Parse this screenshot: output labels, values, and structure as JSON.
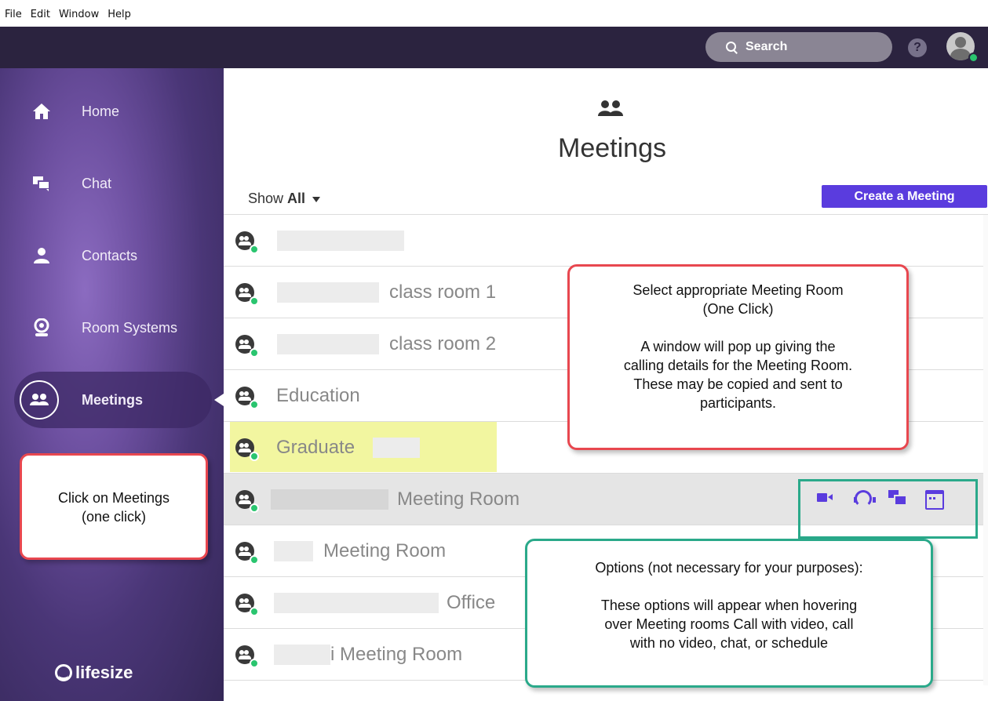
{
  "menu": [
    "File",
    "Edit",
    "Window",
    "Help"
  ],
  "header": {
    "search_label": "Search",
    "help_label": "?"
  },
  "sidebar": {
    "items": [
      {
        "label": "Home"
      },
      {
        "label": "Chat"
      },
      {
        "label": "Contacts"
      },
      {
        "label": "Room Systems"
      },
      {
        "label": "Meetings"
      }
    ],
    "active": "Meetings",
    "logo": "lifesize"
  },
  "main": {
    "title": "Meetings",
    "show_prefix": "Show",
    "show_value": "All",
    "create_button": "Create a Meeting",
    "rows": [
      {
        "name": ""
      },
      {
        "name": "class room 1"
      },
      {
        "name": "class room 2"
      },
      {
        "name": "Education"
      },
      {
        "name": "Graduate"
      },
      {
        "name": "Meeting Room"
      },
      {
        "name": "Meeting Room"
      },
      {
        "name": "Office"
      },
      {
        "name": "i Meeting Room"
      }
    ]
  },
  "callouts": {
    "meeting_room": {
      "line1": "Select appropriate Meeting Room",
      "line2": "(One Click)",
      "line3": "A window will pop up giving the",
      "line4": "calling details for the Meeting Room.",
      "line5": "These may be copied and sent to",
      "line6": "participants."
    },
    "click_meetings": {
      "line1": "Click on Meetings",
      "line2": "(one click)"
    },
    "options": {
      "line1": "Options (not necessary for your purposes):",
      "line2": "These options will appear when hovering",
      "line3": "over Meeting rooms Call with video, call",
      "line4": "with no video, chat, or schedule"
    }
  },
  "colors": {
    "accent": "#5a3cde",
    "presence": "#2ac56f",
    "highlight": "#f2f6a0",
    "callout_red": "#e8474f",
    "callout_green": "#2aa98a"
  }
}
